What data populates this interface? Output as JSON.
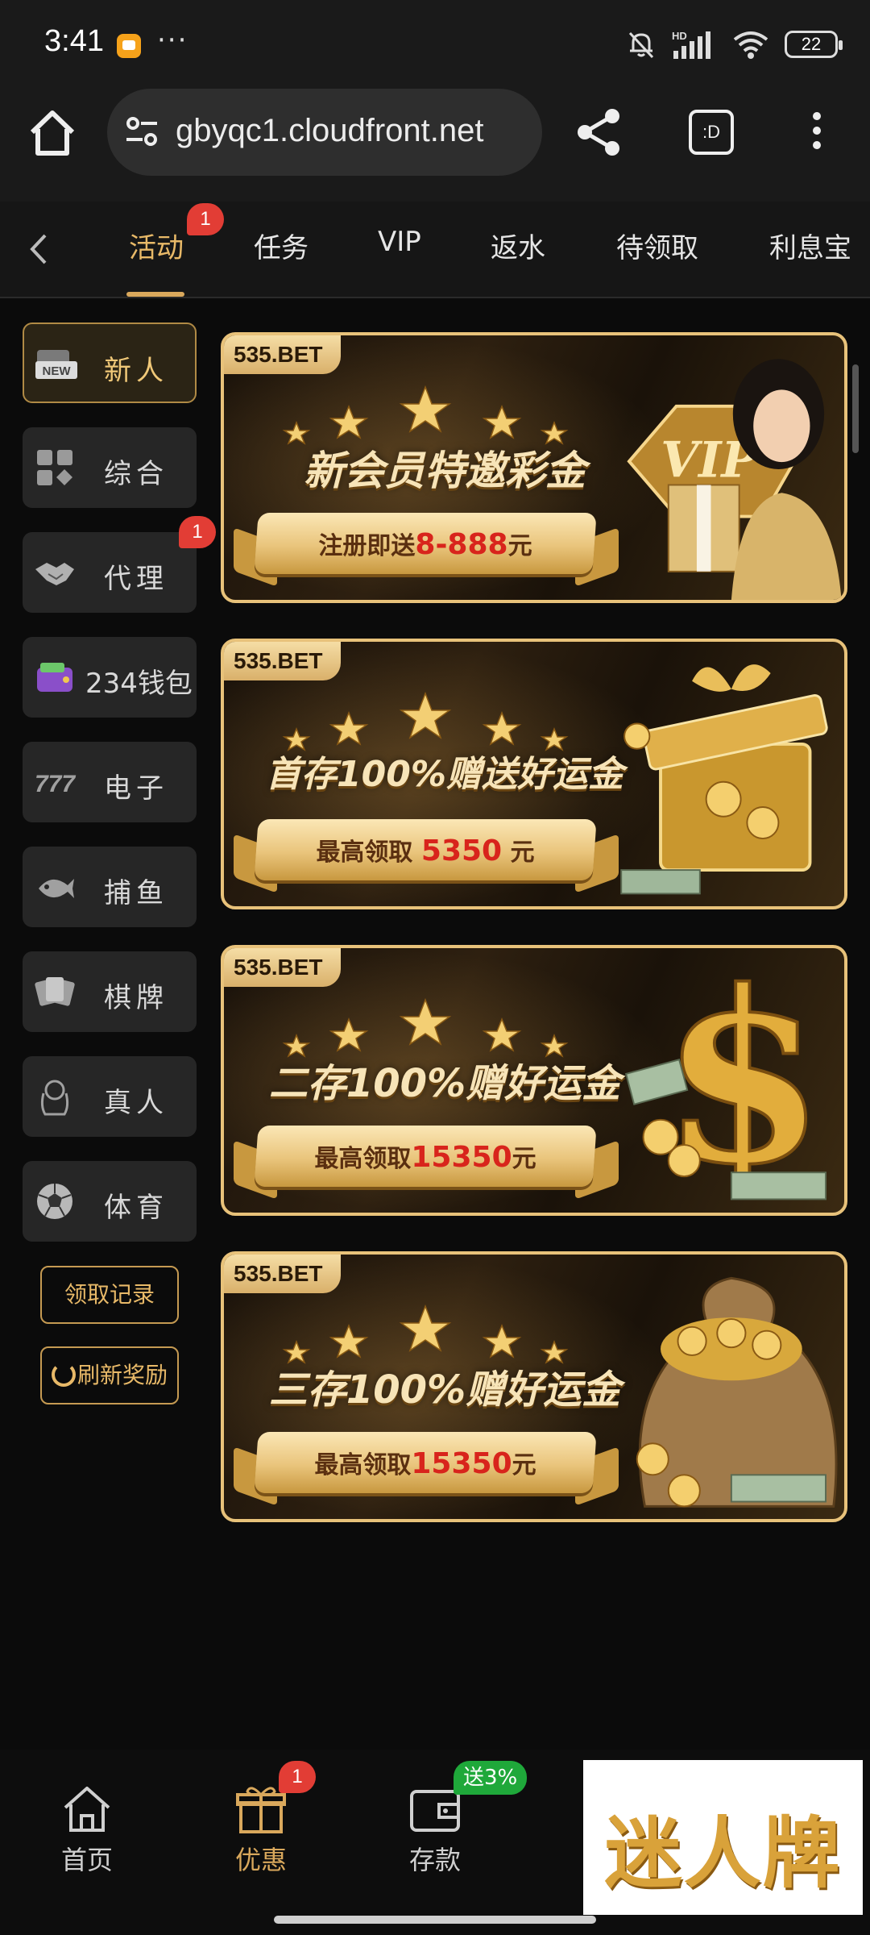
{
  "status_bar": {
    "time": "3:41",
    "dots": "···",
    "battery": "22",
    "network": "HD"
  },
  "browser": {
    "url": "gbyqc1.cloudfront.net",
    "tabs_label": ":D"
  },
  "tabs": [
    {
      "label": "活动",
      "active": true,
      "badge": "1"
    },
    {
      "label": "任务"
    },
    {
      "label": "VIP"
    },
    {
      "label": "返水"
    },
    {
      "label": "待领取"
    },
    {
      "label": "利息宝"
    }
  ],
  "sidebar": {
    "items": [
      {
        "label": "新人",
        "icon": "new-icon",
        "active": true
      },
      {
        "label": "综合",
        "icon": "grid-icon"
      },
      {
        "label": "代理",
        "icon": "handshake-icon",
        "badge": "1"
      },
      {
        "label": "234钱包",
        "icon": "wallet-icon"
      },
      {
        "label": "电子",
        "icon": "slot-777-icon"
      },
      {
        "label": "捕鱼",
        "icon": "fish-icon"
      },
      {
        "label": "棋牌",
        "icon": "cards-icon"
      },
      {
        "label": "真人",
        "icon": "dealer-icon"
      },
      {
        "label": "体育",
        "icon": "soccer-ball-icon"
      }
    ],
    "record_button": "领取记录",
    "refresh_button": "刷新奖励"
  },
  "banners": [
    {
      "brand": "535.BET",
      "title": "新会员特邀彩金",
      "prefix": "注册即送",
      "amount": "8-888",
      "suffix": "元",
      "art": "vip-woman-gift"
    },
    {
      "brand": "535.BET",
      "title": "首存100%赠送好运金",
      "prefix": "最高领取 ",
      "amount": "5350",
      "suffix": " 元",
      "art": "gold-gift-box"
    },
    {
      "brand": "535.BET",
      "title": "二存100%赠好运金",
      "prefix": "最高领取",
      "amount": "15350",
      "suffix": "元",
      "art": "gold-dollar-sign"
    },
    {
      "brand": "535.BET",
      "title": "三存100%赠好运金",
      "prefix": "最高领取",
      "amount": "15350",
      "suffix": "元",
      "art": "gold-coin-sack"
    }
  ],
  "bottom_nav": [
    {
      "label": "首页",
      "icon": "home-icon"
    },
    {
      "label": "优惠",
      "icon": "gift-icon",
      "badge": "1",
      "active": true
    },
    {
      "label": "存款",
      "icon": "wallet-deposit-icon",
      "promo": "送3%"
    }
  ],
  "overlay_logo": "迷人牌",
  "colors": {
    "accent": "#d9a85c",
    "badge": "#e23d35",
    "promo": "#1fa83a",
    "background": "#0b0b0b"
  }
}
